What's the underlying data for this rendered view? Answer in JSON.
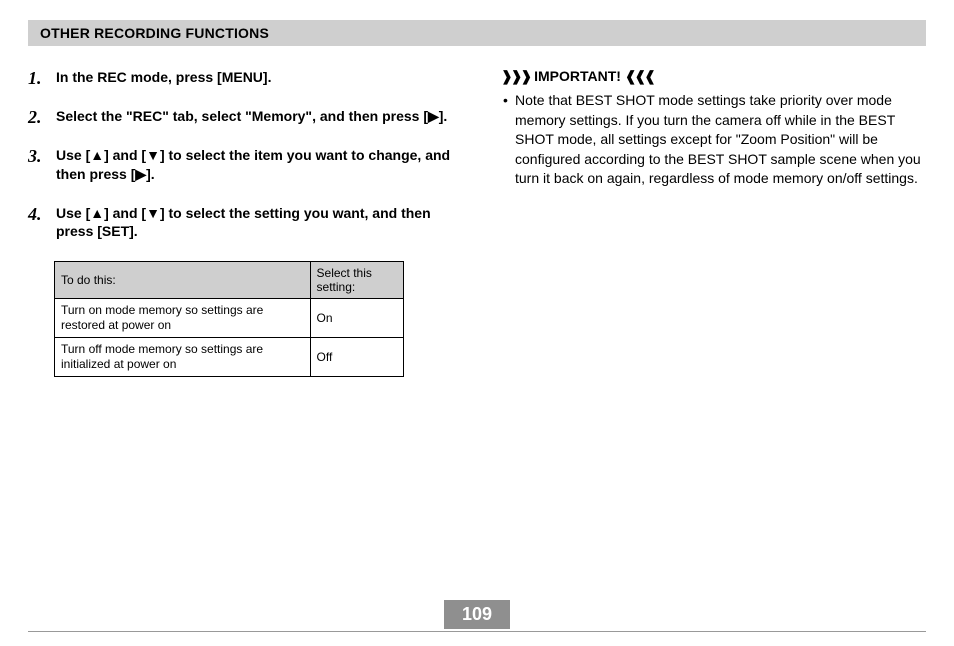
{
  "section_title": "OTHER RECORDING FUNCTIONS",
  "steps": [
    "In the REC mode, press [MENU].",
    "Select the \"REC\" tab, select \"Memory\", and then press [▶].",
    "Use [▲] and [▼] to select the item you want to change, and then press [▶].",
    "Use [▲] and [▼] to select the setting you want, and then press [SET]."
  ],
  "table": {
    "headers": {
      "left": "To do this:",
      "right": "Select this setting:"
    },
    "rows": [
      {
        "action": "Turn on mode memory so settings are restored at power on",
        "setting": "On"
      },
      {
        "action": "Turn off mode memory so settings are initialized at power on",
        "setting": "Off"
      }
    ]
  },
  "important": {
    "label": "IMPORTANT!",
    "deco_left": "❱❱❱",
    "deco_right": "❰❰❰",
    "bullets": [
      "Note that BEST SHOT mode settings take priority over mode memory settings. If you turn the camera off while in the BEST SHOT mode, all settings except for \"Zoom Position\" will be configured according to the BEST SHOT sample scene when you turn it back on again, regardless of mode memory on/off settings."
    ]
  },
  "page_number": "109"
}
